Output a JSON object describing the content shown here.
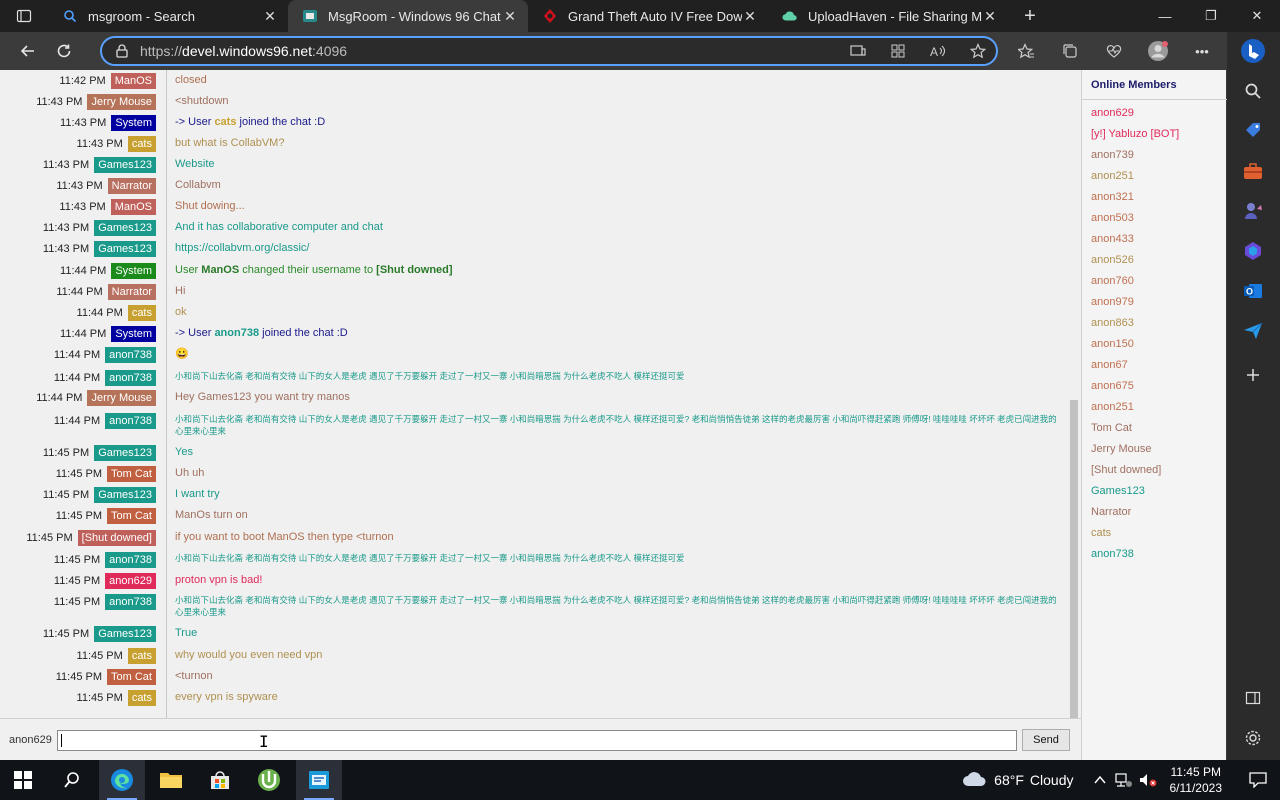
{
  "browser": {
    "tabs": [
      {
        "title": "msgroom - Search",
        "icon": "search-icon",
        "active": false
      },
      {
        "title": "MsgRoom - Windows 96 Chat",
        "icon": "msgroom-icon",
        "active": true
      },
      {
        "title": "Grand Theft Auto IV Free Downlo",
        "icon": "gta-icon",
        "active": false
      },
      {
        "title": "UploadHaven - File Sharing Mad",
        "icon": "cloud-icon",
        "active": false
      }
    ],
    "url_scheme": "https://",
    "url_host": "devel.windows96.net",
    "url_rest": ":4096"
  },
  "chat": {
    "messages": [
      {
        "time": "11:42 PM",
        "user": "ManOS",
        "user_color": "#c0605a",
        "text": "closed",
        "text_color": "#b07050"
      },
      {
        "time": "11:43 PM",
        "user": "Jerry Mouse",
        "user_color": "#b5735a",
        "text": "<shutdown",
        "text_color": "#a07060"
      },
      {
        "time": "11:43 PM",
        "user": "System",
        "user_color": "#0000a0",
        "text_parts": [
          "-> User ",
          "cats",
          " joined the chat :D"
        ],
        "text_color": "#1a1a8a",
        "mention_color": "#c8a030"
      },
      {
        "time": "11:43 PM",
        "user": "cats",
        "user_color": "#c8a030",
        "text": "but what is CollabVM?",
        "text_color": "#b09050"
      },
      {
        "time": "11:43 PM",
        "user": "Games123",
        "user_color": "#1a9a8a",
        "text": "Website",
        "text_color": "#1a9a8a"
      },
      {
        "time": "11:43 PM",
        "user": "Narrator",
        "user_color": "#b87060",
        "text": "Collabvm",
        "text_color": "#a07060"
      },
      {
        "time": "11:43 PM",
        "user": "ManOS",
        "user_color": "#c0605a",
        "text": "Shut dowing...",
        "text_color": "#b07050"
      },
      {
        "time": "11:43 PM",
        "user": "Games123",
        "user_color": "#1a9a8a",
        "text": "And it has collaborative computer and chat",
        "text_color": "#1a9a8a"
      },
      {
        "time": "11:43 PM",
        "user": "Games123",
        "user_color": "#1a9a8a",
        "text": "https://collabvm.org/classic/",
        "text_color": "#1a9a8a"
      },
      {
        "time": "11:44 PM",
        "user": "System",
        "user_color": "#1a8a1a",
        "text_parts": [
          "User ",
          "ManOS",
          " changed their username to ",
          "[Shut downed]"
        ],
        "text_color": "#2a8a2a",
        "mention_color": "#2a7a2a"
      },
      {
        "time": "11:44 PM",
        "user": "Narrator",
        "user_color": "#b87060",
        "text": "Hi",
        "text_color": "#a07060"
      },
      {
        "time": "11:44 PM",
        "user": "cats",
        "user_color": "#c8a030",
        "text": "ok",
        "text_color": "#b09050"
      },
      {
        "time": "11:44 PM",
        "user": "System",
        "user_color": "#0000a0",
        "text_parts": [
          "-> User ",
          "anon738",
          " joined the chat :D"
        ],
        "text_color": "#1a1a8a",
        "mention_color": "#1a9a8a"
      },
      {
        "time": "11:44 PM",
        "user": "anon738",
        "user_color": "#1a9a8a",
        "text": "😀",
        "text_color": "#1a9a8a"
      },
      {
        "time": "11:44 PM",
        "user": "anon738",
        "user_color": "#1a9a8a",
        "text": "小和尚下山去化斋 老和尚有交待 山下的女人是老虎 遇见了千万要躲开 走过了一村又一寨 小和尚暗思揣 为什么老虎不吃人 模样还挺可爱",
        "text_color": "#1a9a8a",
        "small": true
      },
      {
        "time": "11:44 PM",
        "user": "Jerry Mouse",
        "user_color": "#b5735a",
        "text": "Hey Games123 you want try manos",
        "text_color": "#a07060"
      },
      {
        "time": "11:44 PM",
        "user": "anon738",
        "user_color": "#1a9a8a",
        "text": "小和尚下山去化斋 老和尚有交待 山下的女人是老虎 遇见了千万要躲开 走过了一村又一寨 小和尚暗思揣 为什么老虎不吃人 模样还挺可爱? 老和尚悄悄告徒弟 这样的老虎最厉害 小和尚吓得赶紧跑 师傅呀! 哇哇哇哇 坏坏坏 老虎已闯进我的心里来心里来",
        "text_color": "#1a9a8a",
        "small": true
      },
      {
        "time": "11:45 PM",
        "user": "Games123",
        "user_color": "#1a9a8a",
        "text": "Yes",
        "text_color": "#1a9a8a"
      },
      {
        "time": "11:45 PM",
        "user": "Tom Cat",
        "user_color": "#c06040",
        "text": "Uh uh",
        "text_color": "#a07060"
      },
      {
        "time": "11:45 PM",
        "user": "Games123",
        "user_color": "#1a9a8a",
        "text": "I want try",
        "text_color": "#1a9a8a"
      },
      {
        "time": "11:45 PM",
        "user": "Tom Cat",
        "user_color": "#c06040",
        "text": "ManOs turn on",
        "text_color": "#a07060"
      },
      {
        "time": "11:45 PM",
        "user": "[Shut downed]",
        "user_color": "#c0605a",
        "text": "if you want to boot ManOS then type <turnon",
        "text_color": "#b07050"
      },
      {
        "time": "11:45 PM",
        "user": "anon738",
        "user_color": "#1a9a8a",
        "text": "小和尚下山去化斋 老和尚有交待 山下的女人是老虎 遇见了千万要躲开 走过了一村又一寨 小和尚暗思揣 为什么老虎不吃人 模样还挺可爱",
        "text_color": "#1a9a8a",
        "small": true
      },
      {
        "time": "11:45 PM",
        "user": "anon629",
        "user_color": "#e02a5a",
        "text": "proton vpn is bad!",
        "text_color": "#e02a5a"
      },
      {
        "time": "11:45 PM",
        "user": "anon738",
        "user_color": "#1a9a8a",
        "text": "小和尚下山去化斋 老和尚有交待 山下的女人是老虎 遇见了千万要躲开 走过了一村又一寨 小和尚暗思揣 为什么老虎不吃人 模样还挺可爱? 老和尚悄悄告徒弟 这样的老虎最厉害 小和尚吓得赶紧跑 师傅呀! 哇哇哇哇 坏坏坏 老虎已闯进我的心里来心里来",
        "text_color": "#1a9a8a",
        "small": true
      },
      {
        "time": "11:45 PM",
        "user": "Games123",
        "user_color": "#1a9a8a",
        "text": "True",
        "text_color": "#1a9a8a"
      },
      {
        "time": "11:45 PM",
        "user": "cats",
        "user_color": "#c8a030",
        "text": "why would you even need vpn",
        "text_color": "#b09050"
      },
      {
        "time": "11:45 PM",
        "user": "Tom Cat",
        "user_color": "#c06040",
        "text": "<turnon",
        "text_color": "#a07060"
      },
      {
        "time": "11:45 PM",
        "user": "cats",
        "user_color": "#c8a030",
        "text": "every vpn is spyware",
        "text_color": "#b09050"
      }
    ]
  },
  "members": {
    "title": "Online Members",
    "list": [
      {
        "name": "anon629",
        "color": "#e02a5a"
      },
      {
        "name": "[y!] Yabluzo [BOT]",
        "color": "#e02a5a"
      },
      {
        "name": "anon739",
        "color": "#a07060"
      },
      {
        "name": "anon251",
        "color": "#b09050"
      },
      {
        "name": "anon321",
        "color": "#c07050"
      },
      {
        "name": "anon503",
        "color": "#c07050"
      },
      {
        "name": "anon433",
        "color": "#c07050"
      },
      {
        "name": "anon526",
        "color": "#b09050"
      },
      {
        "name": "anon760",
        "color": "#c07050"
      },
      {
        "name": "anon979",
        "color": "#c07050"
      },
      {
        "name": "anon863",
        "color": "#b09050"
      },
      {
        "name": "anon150",
        "color": "#c07050"
      },
      {
        "name": "anon67",
        "color": "#c07050"
      },
      {
        "name": "anon675",
        "color": "#c07050"
      },
      {
        "name": "anon251",
        "color": "#c07050"
      },
      {
        "name": "Tom Cat",
        "color": "#a07060"
      },
      {
        "name": "Jerry Mouse",
        "color": "#a07060"
      },
      {
        "name": "[Shut downed]",
        "color": "#a07060"
      },
      {
        "name": "Games123",
        "color": "#1a9a8a"
      },
      {
        "name": "Narrator",
        "color": "#a07060"
      },
      {
        "name": "cats",
        "color": "#b09050"
      },
      {
        "name": "anon738",
        "color": "#1a9a8a"
      }
    ]
  },
  "composer": {
    "nickname": "anon629",
    "value": "",
    "send_label": "Send"
  },
  "taskbar": {
    "weather_temp": "68°F",
    "weather_desc": "Cloudy",
    "time": "11:45 PM",
    "date": "6/11/2023"
  }
}
